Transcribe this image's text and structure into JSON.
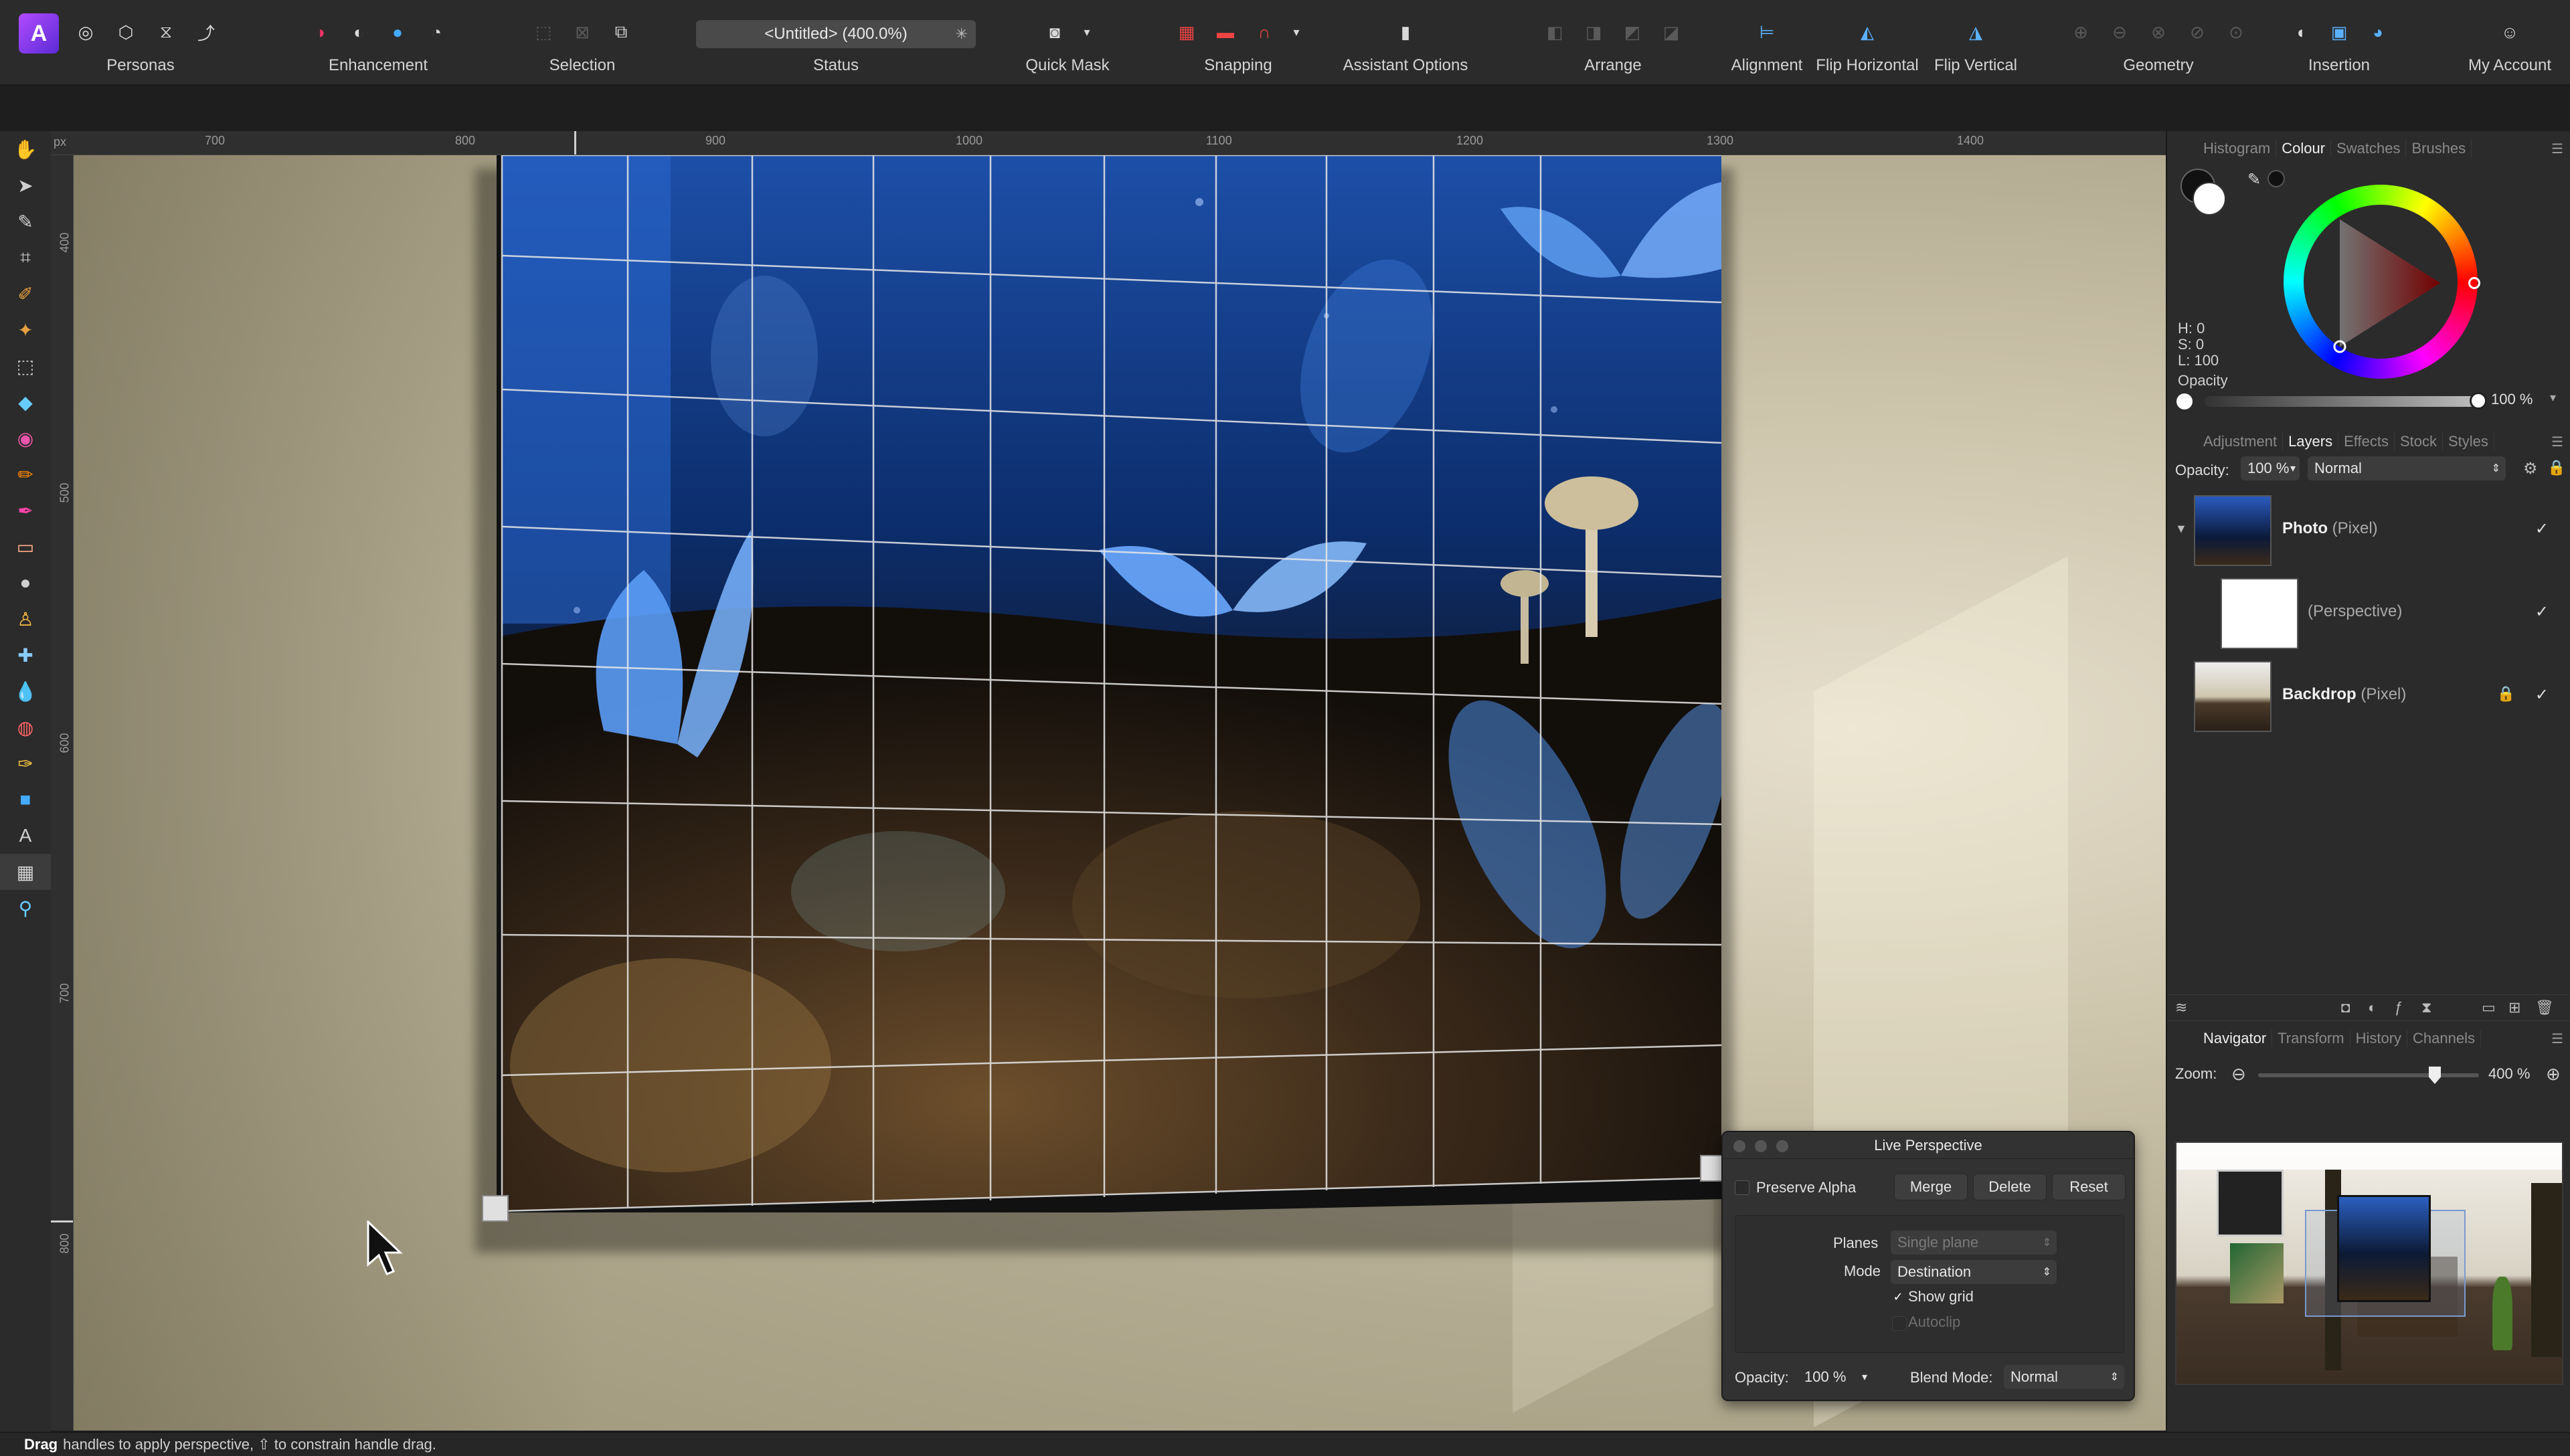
{
  "toolbar": {
    "personas_label": "Personas",
    "enhancement_label": "Enhancement",
    "selection_label": "Selection",
    "status_label": "Status",
    "status_value": "<Untitled> (400.0%)",
    "quick_mask_label": "Quick Mask",
    "snapping_label": "Snapping",
    "assistant_label": "Assistant Options",
    "arrange_label": "Arrange",
    "alignment_label": "Alignment",
    "flip_h_label": "Flip Horizontal",
    "flip_v_label": "Flip Vertical",
    "geometry_label": "Geometry",
    "insertion_label": "Insertion",
    "account_label": "My Account"
  },
  "ruler": {
    "unit": "px",
    "top_marks": [
      "700",
      "800",
      "900",
      "1000",
      "1100",
      "1200",
      "1300",
      "1400"
    ],
    "left_marks": [
      "400",
      "500",
      "600",
      "700",
      "800"
    ]
  },
  "panels": {
    "top_tabs": [
      "Histogram",
      "Colour",
      "Swatches",
      "Brushes"
    ],
    "top_active": "Colour",
    "colour": {
      "h": "H: 0",
      "s": "S: 0",
      "l": "L: 100",
      "opacity_label": "Opacity",
      "opacity_value": "100 %",
      "opacity_level": 1.0
    },
    "layer_tabs": [
      "Adjustment",
      "Layers",
      "Effects",
      "Stock",
      "Styles"
    ],
    "layer_active": "Layers",
    "layers_opacity_label": "Opacity:",
    "layers_opacity_value": "100 %",
    "layers_blend": "Normal",
    "layers": [
      {
        "name": "Photo",
        "kind": "(Pixel)",
        "checked": "✓"
      },
      {
        "name": "",
        "kind": "(Perspective)",
        "checked": "✓"
      },
      {
        "name": "Backdrop",
        "kind": "(Pixel)",
        "checked": "✓"
      }
    ],
    "nav_tabs": [
      "Navigator",
      "Transform",
      "History",
      "Channels"
    ],
    "nav_active": "Navigator",
    "zoom_label": "Zoom:",
    "zoom_value": "400 %",
    "zoom_level": 0.8
  },
  "dialog": {
    "title": "Live Perspective",
    "preserve_alpha": "Preserve Alpha",
    "merge": "Merge",
    "delete": "Delete",
    "reset": "Reset",
    "planes_label": "Planes",
    "planes_value": "Single plane",
    "mode_label": "Mode",
    "mode_value": "Destination",
    "show_grid": "Show grid",
    "autoclip": "Autoclip",
    "opacity_label": "Opacity:",
    "opacity_value": "100 %",
    "blend_label": "Blend Mode:",
    "blend_value": "Normal"
  },
  "statusbar": {
    "action": "Drag",
    "hint": "handles to apply perspective, ⇧ to constrain handle drag."
  }
}
